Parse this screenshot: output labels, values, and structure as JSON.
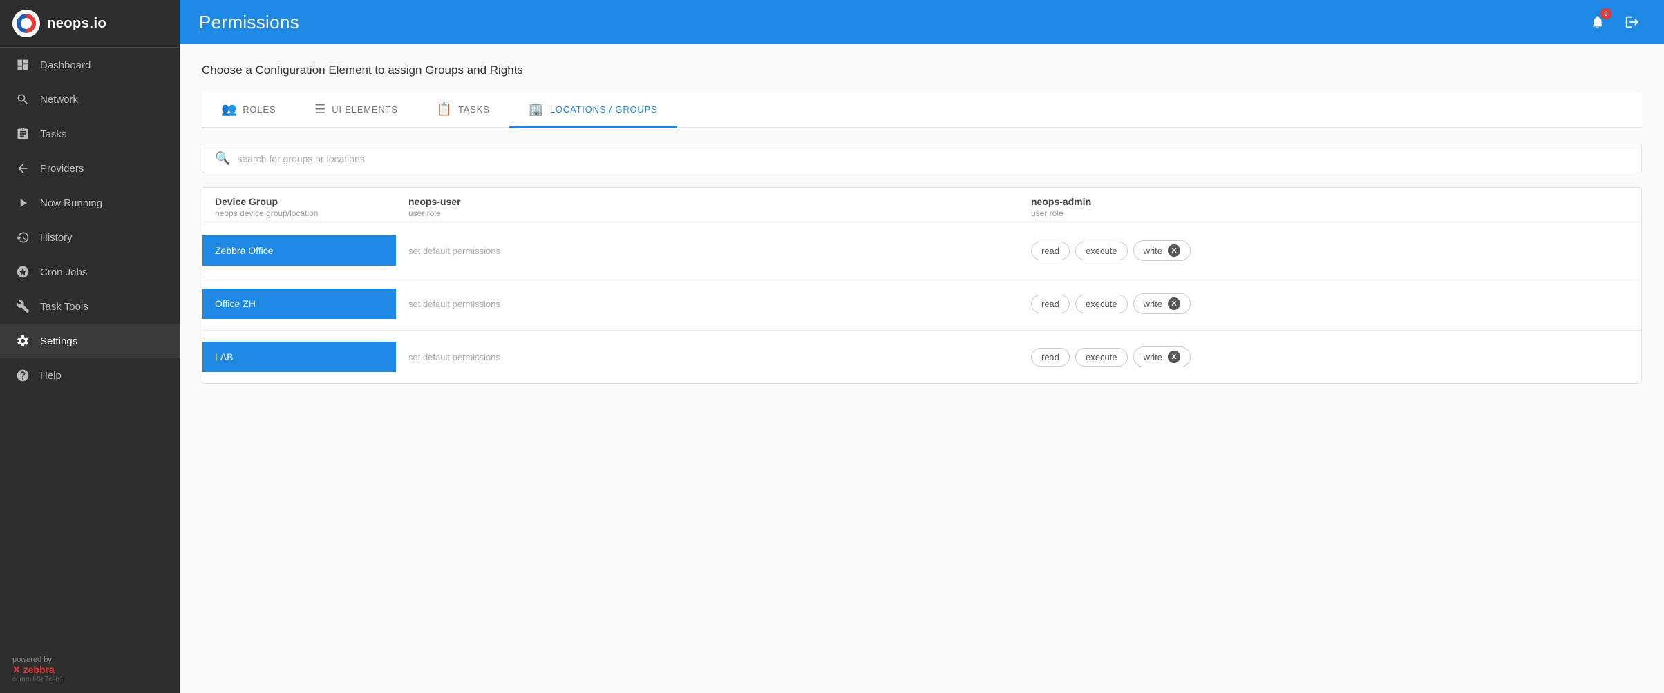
{
  "app": {
    "logo_text": "neops.io",
    "header_title": "Permissions",
    "notification_count": "0"
  },
  "sidebar": {
    "items": [
      {
        "id": "dashboard",
        "label": "Dashboard",
        "icon": "dashboard"
      },
      {
        "id": "network",
        "label": "Network",
        "icon": "network"
      },
      {
        "id": "tasks",
        "label": "Tasks",
        "icon": "tasks"
      },
      {
        "id": "providers",
        "label": "Providers",
        "icon": "providers"
      },
      {
        "id": "now-running",
        "label": "Now Running",
        "icon": "now-running"
      },
      {
        "id": "history",
        "label": "History",
        "icon": "history"
      },
      {
        "id": "cron-jobs",
        "label": "Cron Jobs",
        "icon": "cron-jobs"
      },
      {
        "id": "task-tools",
        "label": "Task Tools",
        "icon": "task-tools"
      },
      {
        "id": "settings",
        "label": "Settings",
        "icon": "settings",
        "active": true
      },
      {
        "id": "help",
        "label": "Help",
        "icon": "help"
      }
    ],
    "footer": {
      "powered_by": "powered by",
      "brand": "zebbra",
      "commit": "commit-5e7c9b1"
    }
  },
  "main": {
    "description": "Choose a Configuration Element to assign Groups and Rights",
    "tabs": [
      {
        "id": "roles",
        "label": "ROLES",
        "icon": "👥",
        "active": false
      },
      {
        "id": "ui-elements",
        "label": "UI ELEMENTS",
        "icon": "☰",
        "active": false
      },
      {
        "id": "tasks",
        "label": "TASKS",
        "icon": "📋",
        "active": false
      },
      {
        "id": "locations-groups",
        "label": "LOCATIONS / GROUPS",
        "icon": "🏢",
        "active": true
      }
    ],
    "search": {
      "placeholder": "search for groups or locations"
    },
    "table": {
      "columns": [
        {
          "title": "Device Group",
          "subtitle": "neops device group/location"
        },
        {
          "title": "neops-user",
          "subtitle": "user role"
        },
        {
          "title": "neops-admin",
          "subtitle": "user role"
        }
      ],
      "rows": [
        {
          "device": "Zebbra Office",
          "user_perm": "set default permissions",
          "admin_perms": [
            "read",
            "execute",
            "write"
          ]
        },
        {
          "device": "Office ZH",
          "user_perm": "set default permissions",
          "admin_perms": [
            "read",
            "execute",
            "write"
          ]
        },
        {
          "device": "LAB",
          "user_perm": "set default permissions",
          "admin_perms": [
            "read",
            "execute",
            "write"
          ]
        }
      ]
    }
  }
}
